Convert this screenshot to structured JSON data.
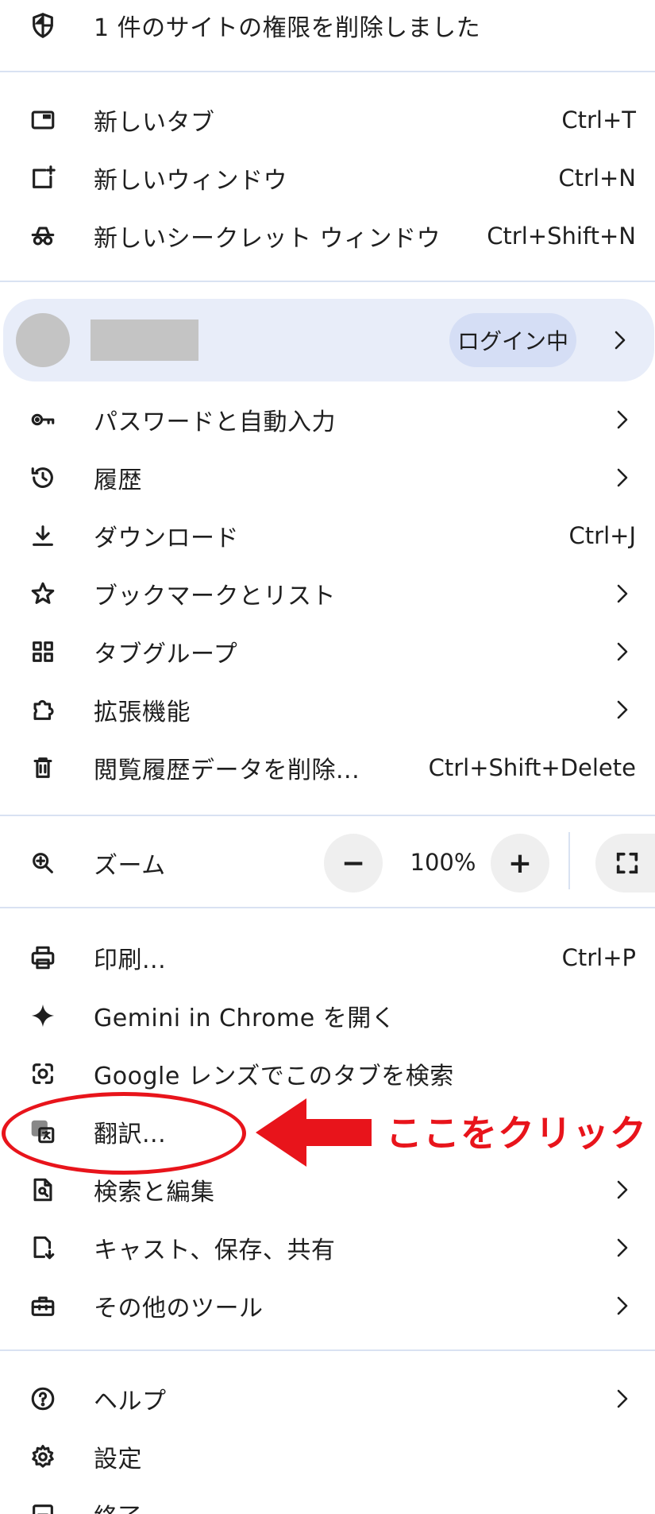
{
  "notice": {
    "text": "1 件のサイトの権限を削除しました",
    "icon": "shield-icon"
  },
  "new_group": [
    {
      "label": "新しいタブ",
      "shortcut": "Ctrl+T",
      "icon": "new-tab-icon"
    },
    {
      "label": "新しいウィンドウ",
      "shortcut": "Ctrl+N",
      "icon": "new-window-icon"
    },
    {
      "label": "新しいシークレット ウィンドウ",
      "shortcut": "Ctrl+Shift+N",
      "icon": "incognito-icon"
    }
  ],
  "profile": {
    "status": "ログイン中"
  },
  "main_group": [
    {
      "label": "パスワードと自動入力",
      "icon": "key-icon"
    },
    {
      "label": "履歴",
      "icon": "history-icon"
    },
    {
      "label": "ダウンロード",
      "shortcut": "Ctrl+J",
      "icon": "download-icon"
    },
    {
      "label": "ブックマークとリスト",
      "icon": "star-icon"
    },
    {
      "label": "タブグループ",
      "icon": "tab-groups-icon"
    },
    {
      "label": "拡張機能",
      "icon": "extension-icon"
    },
    {
      "label": "閲覧履歴データを削除...",
      "shortcut": "Ctrl+Shift+Delete",
      "icon": "trash-icon"
    }
  ],
  "zoom": {
    "label": "ズーム",
    "minus": "−",
    "level": "100%",
    "plus": "+",
    "icon": "zoom-icon"
  },
  "tools_group": [
    {
      "label": "印刷...",
      "shortcut": "Ctrl+P",
      "icon": "print-icon"
    },
    {
      "label": "Gemini in Chrome を開く",
      "icon": "sparkle-icon"
    },
    {
      "label": "Google レンズでこのタブを検索",
      "icon": "lens-icon"
    },
    {
      "label": "翻訳...",
      "icon": "translate-icon"
    },
    {
      "label": "検索と編集",
      "icon": "find-icon"
    },
    {
      "label": "キャスト、保存、共有",
      "icon": "cast-icon"
    },
    {
      "label": "その他のツール",
      "icon": "toolbox-icon"
    }
  ],
  "bottom_group": [
    {
      "label": "ヘルプ",
      "icon": "help-icon"
    },
    {
      "label": "設定",
      "icon": "gear-icon"
    },
    {
      "label": "終了",
      "icon": "exit-icon"
    }
  ],
  "annotation": {
    "text": "ここをクリック",
    "color": "#e8141b"
  },
  "colors": {
    "separator": "#d9e2f2",
    "profile_bg": "#e8edf9",
    "pill_bg": "#d5def5"
  }
}
